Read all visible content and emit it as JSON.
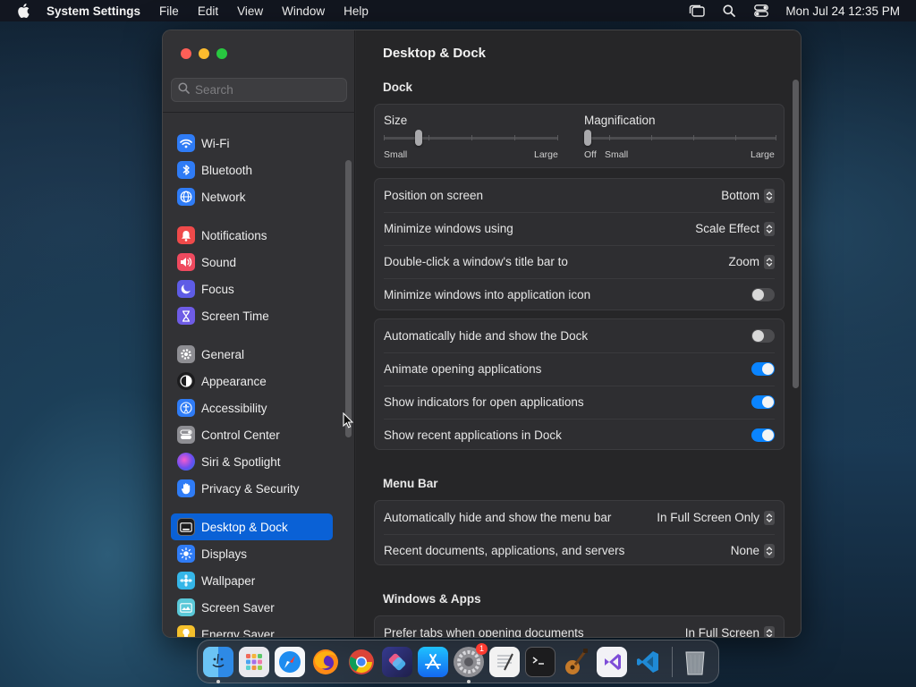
{
  "menubar": {
    "app_name": "System Settings",
    "menus": [
      "File",
      "Edit",
      "View",
      "Window",
      "Help"
    ],
    "clock": "Mon Jul 24  12:35 PM"
  },
  "sidebar": {
    "search_placeholder": "Search",
    "items": [
      {
        "label": "Wi-Fi",
        "icon": "wifi-icon",
        "color": "#2f7cf6"
      },
      {
        "label": "Bluetooth",
        "icon": "bluetooth-icon",
        "color": "#2f7cf6"
      },
      {
        "label": "Network",
        "icon": "globe-icon",
        "color": "#2f7cf6"
      },
      {
        "label": "Notifications",
        "icon": "bell-icon",
        "color": "#ef4a4a"
      },
      {
        "label": "Sound",
        "icon": "speaker-icon",
        "color": "#ef4a5f"
      },
      {
        "label": "Focus",
        "icon": "moon-icon",
        "color": "#5e5ce6"
      },
      {
        "label": "Screen Time",
        "icon": "hourglass-icon",
        "color": "#6e5ce6"
      },
      {
        "label": "General",
        "icon": "gear-icon",
        "color": "#8e8e93"
      },
      {
        "label": "Appearance",
        "icon": "appearance-icon",
        "color": "#1c1c1e"
      },
      {
        "label": "Accessibility",
        "icon": "accessibility-icon",
        "color": "#2f7cf6"
      },
      {
        "label": "Control Center",
        "icon": "control-center-icon",
        "color": "#8e8e93"
      },
      {
        "label": "Siri & Spotlight",
        "icon": "siri-icon",
        "color": "#c247e0"
      },
      {
        "label": "Privacy & Security",
        "icon": "hand-icon",
        "color": "#2f7cf6"
      },
      {
        "label": "Desktop & Dock",
        "icon": "dock-icon",
        "color": "#1c1c1e"
      },
      {
        "label": "Displays",
        "icon": "sun-icon",
        "color": "#2f7cf6"
      },
      {
        "label": "Wallpaper",
        "icon": "wallpaper-icon",
        "color": "#35b6e8"
      },
      {
        "label": "Screen Saver",
        "icon": "screensaver-icon",
        "color": "#5ac8d8"
      },
      {
        "label": "Energy Saver",
        "icon": "battery-icon",
        "color": "#f5c02c"
      }
    ],
    "active_index": 13
  },
  "main": {
    "title": "Desktop & Dock",
    "dock_section": "Dock",
    "size": {
      "label": "Size",
      "min": "Small",
      "max": "Large",
      "value": 0.2
    },
    "magnification": {
      "label": "Magnification",
      "off": "Off",
      "min": "Small",
      "max": "Large",
      "value": 0.0
    },
    "dock_rows": [
      {
        "label": "Position on screen",
        "type": "popup",
        "value": "Bottom"
      },
      {
        "label": "Minimize windows using",
        "type": "popup",
        "value": "Scale Effect"
      },
      {
        "label": "Double-click a window's title bar to",
        "type": "popup",
        "value": "Zoom"
      },
      {
        "label": "Minimize windows into application icon",
        "type": "toggle",
        "on": false
      }
    ],
    "dock_toggles": [
      {
        "label": "Automatically hide and show the Dock",
        "on": false
      },
      {
        "label": "Animate opening applications",
        "on": true
      },
      {
        "label": "Show indicators for open applications",
        "on": true
      },
      {
        "label": "Show recent applications in Dock",
        "on": true
      }
    ],
    "menubar_section": "Menu Bar",
    "menubar_rows": [
      {
        "label": "Automatically hide and show the menu bar",
        "value": "In Full Screen Only"
      },
      {
        "label": "Recent documents, applications, and servers",
        "value": "None"
      }
    ],
    "windows_section": "Windows & Apps",
    "windows_rows": [
      {
        "label": "Prefer tabs when opening documents",
        "value": "In Full Screen"
      }
    ]
  },
  "dock": {
    "apps": [
      {
        "name": "Finder",
        "icon": "finder-icon",
        "running": true
      },
      {
        "name": "Launchpad",
        "icon": "launchpad-icon",
        "running": false
      },
      {
        "name": "Safari",
        "icon": "safari-icon",
        "running": false
      },
      {
        "name": "Firefox",
        "icon": "firefox-icon",
        "running": false
      },
      {
        "name": "Chrome",
        "icon": "chrome-icon",
        "running": false
      },
      {
        "name": "Shortcuts",
        "icon": "shortcuts-icon",
        "running": false
      },
      {
        "name": "App Store",
        "icon": "app-store-icon",
        "running": false
      },
      {
        "name": "System Settings",
        "icon": "system-settings-icon",
        "running": true,
        "badge": "1"
      },
      {
        "name": "TextEdit",
        "icon": "textedit-icon",
        "running": false
      },
      {
        "name": "Terminal",
        "icon": "terminal-icon",
        "running": false
      },
      {
        "name": "Instruments",
        "icon": "guitar-icon",
        "running": false
      },
      {
        "name": "Visual Studio",
        "icon": "visual-studio-icon",
        "running": false
      },
      {
        "name": "VS Code",
        "icon": "vscode-icon",
        "running": false
      }
    ],
    "trash": "trash-icon"
  }
}
